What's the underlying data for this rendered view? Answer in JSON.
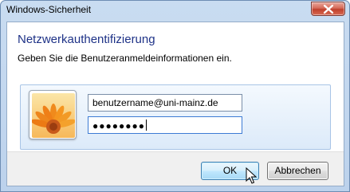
{
  "window": {
    "title": "Windows-Sicherheit",
    "close_icon": "close-icon"
  },
  "dialog": {
    "heading": "Netzwerkauthentifizierung",
    "subheading": "Geben Sie die Benutzeranmeldeinformationen ein."
  },
  "credentials": {
    "avatar_icon": "flower-avatar-icon",
    "username_value": "benutzername@uni-mainz.de",
    "password_value": "●●●●●●●●"
  },
  "buttons": {
    "ok_label": "OK",
    "cancel_label": "Abbrechen"
  },
  "colors": {
    "heading": "#1e3287",
    "frame": "#bcd2ec",
    "close_button": "#c0402c",
    "focus_border": "#3d7bd4"
  }
}
